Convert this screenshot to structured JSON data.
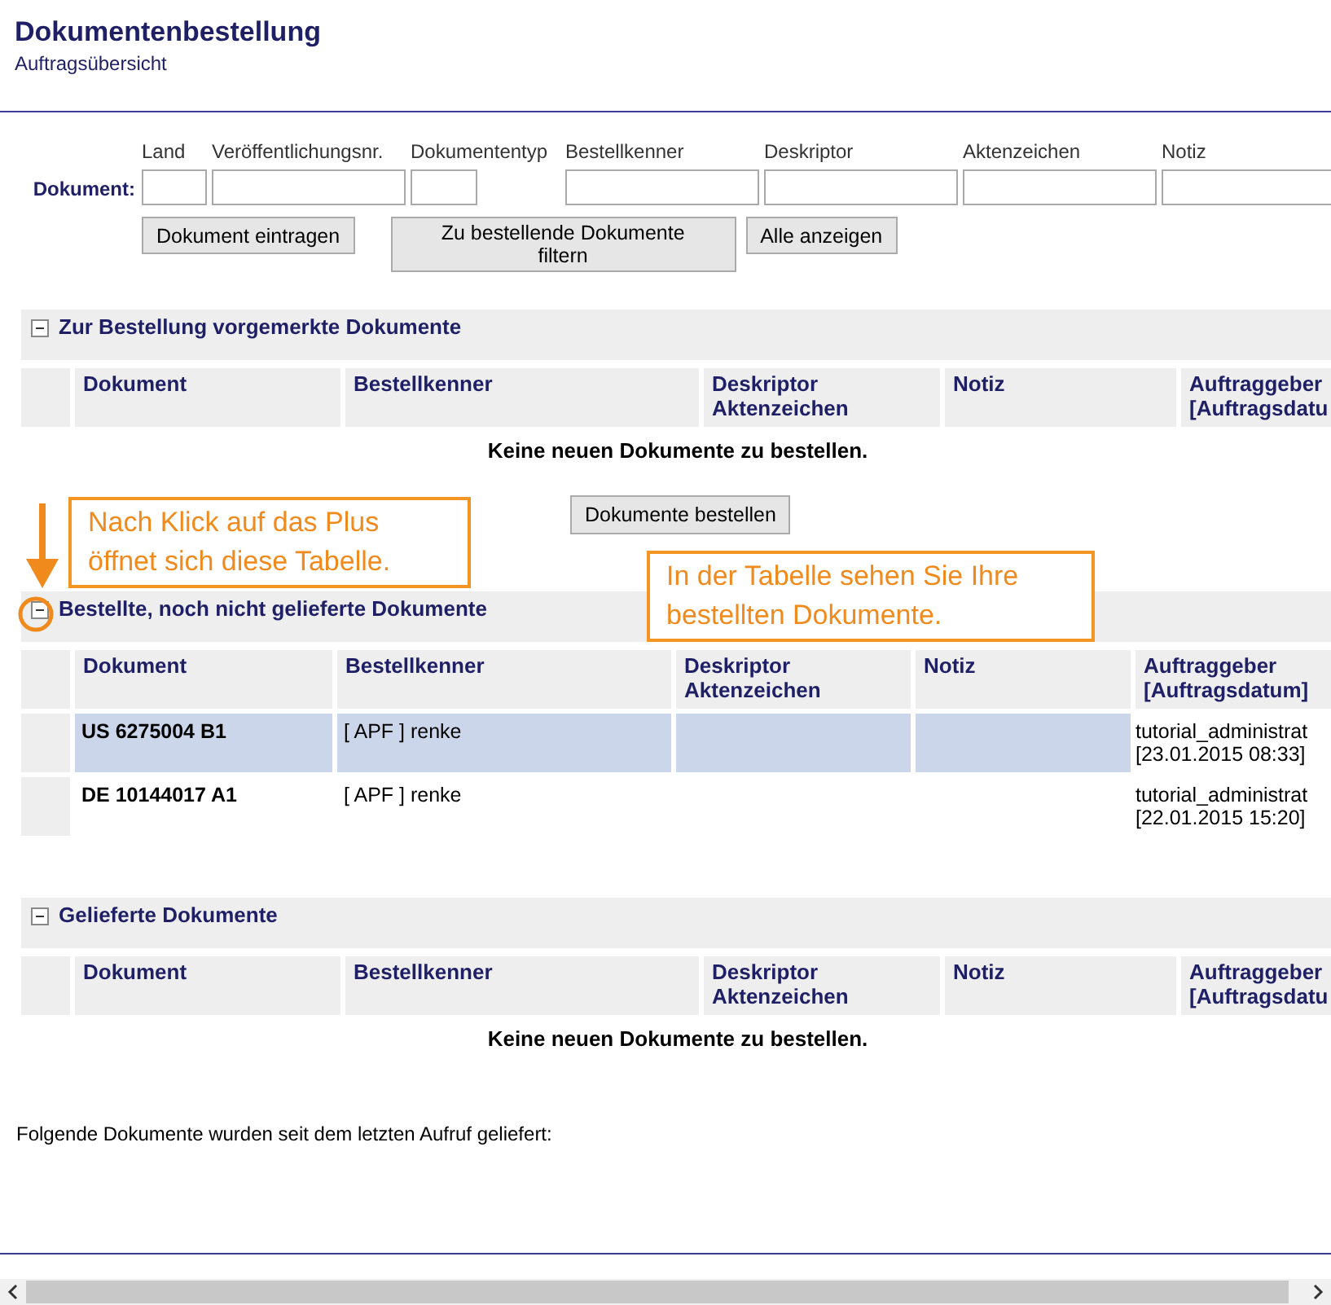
{
  "header": {
    "title": "Dokumentenbestellung",
    "subtitle": "Auftragsübersicht"
  },
  "form": {
    "label": "Dokument:",
    "fields": [
      {
        "label": "Land"
      },
      {
        "label": "Veröffentlichungsnr."
      },
      {
        "label": "Dokumententyp"
      },
      {
        "label": "Bestellkenner"
      },
      {
        "label": "Deskriptor"
      },
      {
        "label": "Aktenzeichen"
      },
      {
        "label": "Notiz"
      }
    ],
    "buttons": [
      "Dokument eintragen",
      "Zu bestellende Dokumente filtern",
      "Alle anzeigen"
    ]
  },
  "sections": [
    {
      "title": "Zur Bestellung vorgemerkte Dokumente",
      "expanded": true,
      "columns": [
        [
          "Dokument"
        ],
        [
          "Bestellkenner"
        ],
        [
          "Deskriptor",
          "Aktenzeichen"
        ],
        [
          "Notiz"
        ],
        [
          "Auftraggeber",
          "[Auftragsdatu"
        ]
      ],
      "empty_message": "Keine neuen Dokumente zu bestellen.",
      "action_button": "Dokumente bestellen"
    },
    {
      "title": "Bestellte, noch nicht gelieferte Dokumente",
      "expanded": true,
      "columns": [
        [
          "Dokument"
        ],
        [
          "Bestellkenner"
        ],
        [
          "Deskriptor",
          "Aktenzeichen"
        ],
        [
          "Notiz"
        ],
        [
          "Auftraggeber",
          "[Auftragsdatum]"
        ]
      ],
      "rows": [
        {
          "selected": true,
          "dokument": "US 6275004 B1",
          "bestellkenner": "[ APF ] renke",
          "auftraggeber": [
            "tutorial_administrat",
            "[23.01.2015 08:33]"
          ]
        },
        {
          "selected": false,
          "dokument": "DE 10144017 A1",
          "bestellkenner": "[ APF ] renke",
          "auftraggeber": [
            "tutorial_administrat",
            "[22.01.2015 15:20]"
          ]
        }
      ]
    },
    {
      "title": "Gelieferte Dokumente",
      "expanded": true,
      "columns": [
        [
          "Dokument"
        ],
        [
          "Bestellkenner"
        ],
        [
          "Deskriptor",
          "Aktenzeichen"
        ],
        [
          "Notiz"
        ],
        [
          "Auftraggeber",
          "[Auftragsdatu"
        ]
      ],
      "empty_message": "Keine neuen Dokumente zu bestellen."
    }
  ],
  "footer_text": "Folgende Dokumente wurden seit dem letzten Aufruf geliefert:",
  "callouts": [
    "Nach Klick auf das Plus öffnet sich diese Tabelle.",
    "In der Tabelle sehen Sie Ihre bestellten Dokumente."
  ]
}
